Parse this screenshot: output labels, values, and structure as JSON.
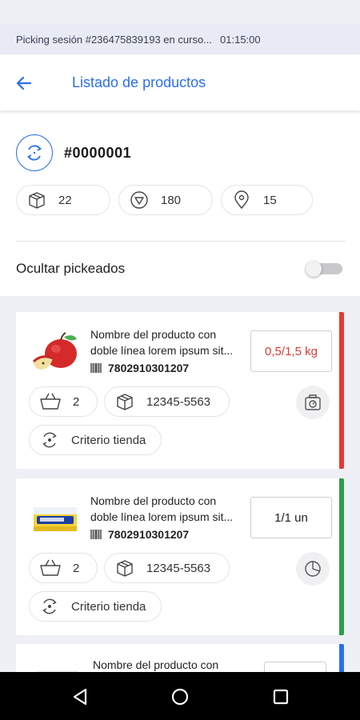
{
  "session": {
    "text": "Picking sesión #236475839193 en curso...",
    "time": "01:15:00"
  },
  "appbar": {
    "title": "Listado de productos"
  },
  "order": {
    "number": "#0000001",
    "chips": [
      {
        "icon": "box-icon",
        "value": "22"
      },
      {
        "icon": "triangle-down-icon",
        "value": "180"
      },
      {
        "icon": "location-pin-icon",
        "value": "15"
      }
    ],
    "hide_label": "Ocultar pickeados",
    "hide_toggle_on": false
  },
  "products": [
    {
      "name_line1": "Nombre del producto con",
      "name_line2": "doble línea lorem ipsum sit...",
      "barcode": "7802910301207",
      "qty_picked": "0,5",
      "qty_total": "/1,5 kg",
      "basket": "2",
      "code": "12345-5563",
      "criteria": "Criterio tienda",
      "action_icon": "scale-icon",
      "status_color": "#e53935"
    },
    {
      "name_line1": "Nombre del producto con",
      "name_line2": "doble línea lorem ipsum sit...",
      "barcode": "7802910301207",
      "qty_picked": "1",
      "qty_total": "/1 un",
      "basket": "2",
      "code": "12345-5563",
      "criteria": "Criterio tienda",
      "action_icon": "pie-chart-icon",
      "status_color": "#2e9d4a"
    },
    {
      "name_line1": "Nombre del producto con",
      "status_color": "#2a6ff0"
    }
  ],
  "colors": {
    "accent": "#2a6ff0",
    "alert": "#e53935",
    "success": "#2e9d4a"
  }
}
